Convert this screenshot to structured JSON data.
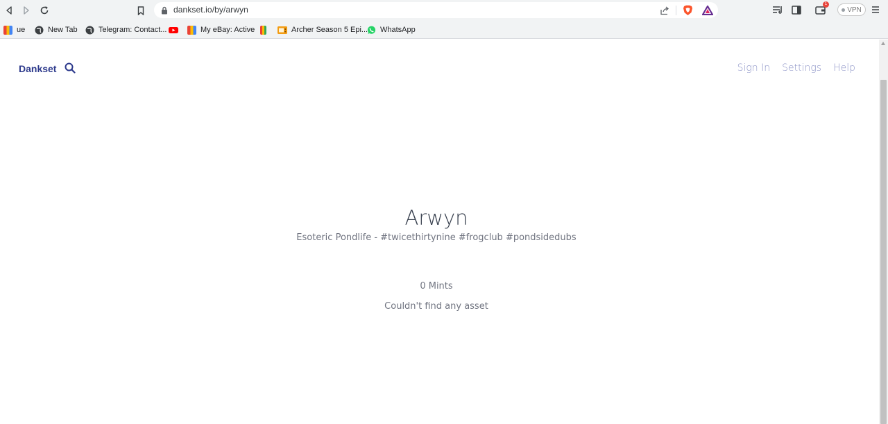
{
  "browser": {
    "url": "dankset.io/by/arwyn",
    "vpn_label": "VPN",
    "notification_count": "1"
  },
  "bookmarks": [
    {
      "label": "ue",
      "icon": "shopping-bag-icon",
      "color": "#f4b400"
    },
    {
      "label": "New Tab",
      "icon": "globe-icon",
      "color": "#5f6368"
    },
    {
      "label": "Telegram: Contact...",
      "icon": "globe-icon",
      "color": "#5f6368"
    },
    {
      "label": "",
      "icon": "youtube-icon",
      "color": "#ff0000"
    },
    {
      "label": "My eBay: Active",
      "icon": "shopping-bag-icon",
      "color": "#f4b400"
    },
    {
      "label": "",
      "icon": "shopping-bag-icon",
      "color": "#f4b400"
    },
    {
      "label": "Archer Season 5 Epi...",
      "icon": "tv-icon",
      "color": "#f39c12"
    },
    {
      "label": "WhatsApp",
      "icon": "whatsapp-icon",
      "color": "#25d366"
    }
  ],
  "header": {
    "brand": "Dankset",
    "nav": [
      "Sign In",
      "Settings",
      "Help"
    ]
  },
  "profile": {
    "name": "Arwyn",
    "bio": "Esoteric Pondlife - #twicethirtynine #frogclub #pondsidedubs",
    "mints": "0 Mints",
    "empty_message": "Couldn't find any asset"
  },
  "colors": {
    "brand": "#2d3a8c",
    "nav_link": "#8f96c8",
    "heading": "#3a4250",
    "muted_text": "#707480"
  }
}
